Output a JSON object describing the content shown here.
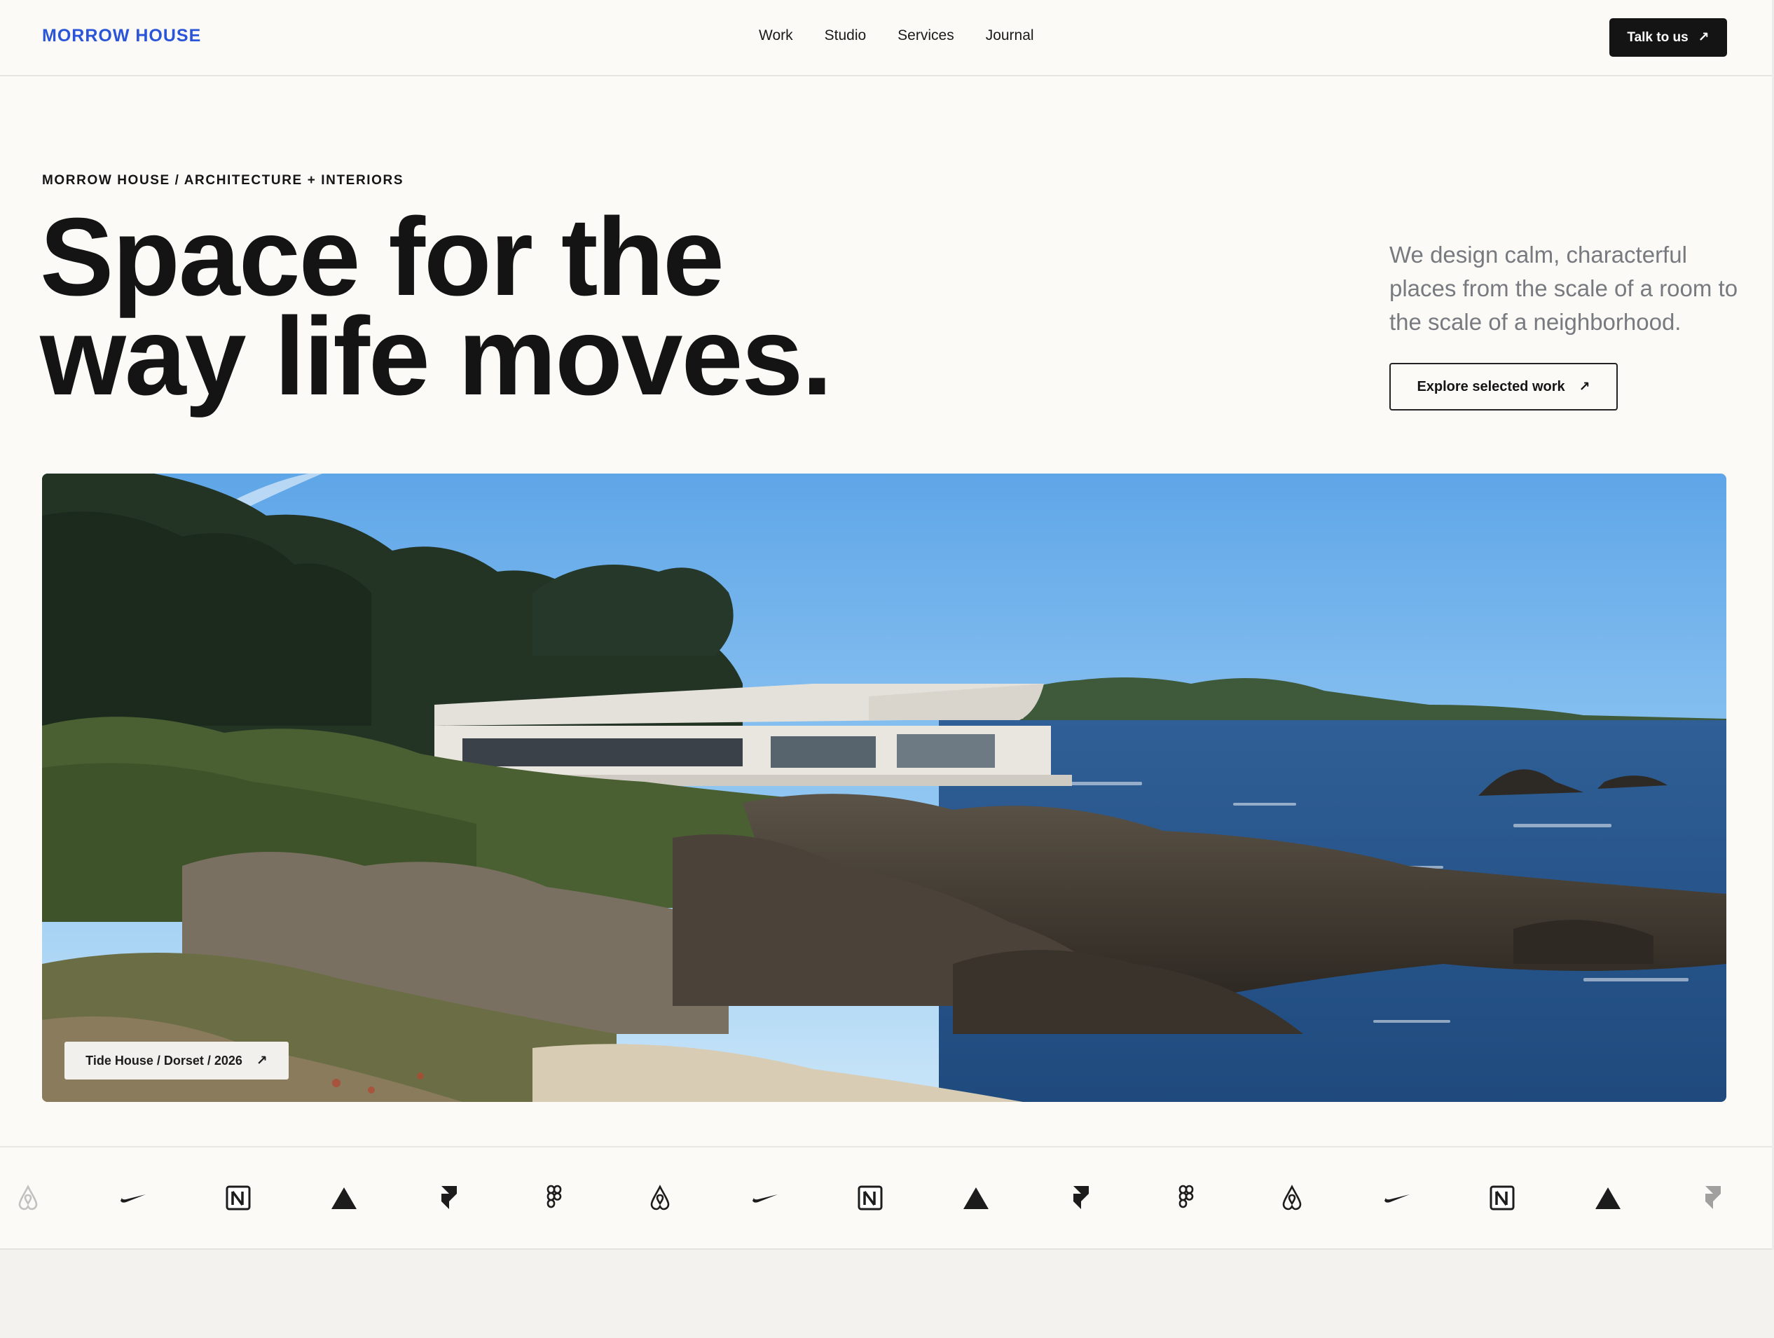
{
  "header": {
    "logo": "MORROW HOUSE",
    "nav": [
      "Work",
      "Studio",
      "Services",
      "Journal"
    ],
    "cta_label": "Talk to us",
    "cta_icon": "arrow-up-right-icon"
  },
  "hero": {
    "eyebrow": "MORROW HOUSE / ARCHITECTURE + INTERIORS",
    "headline_line1": "Space for the",
    "headline_line2": "way life moves.",
    "lede": "We design calm, characterful places from the scale of a room to the scale of a neighborhood.",
    "explore_label": "Explore selected work",
    "explore_icon": "arrow-up-right-icon"
  },
  "feature_image": {
    "subject": "coastal-house-photo",
    "caption": "Tide House / Dorset / 2026",
    "caption_icon": "arrow-up-right-icon"
  },
  "client_logos": [
    "airbnb-logo-icon",
    "nike-swoosh-icon",
    "notion-logo-icon",
    "vercel-triangle-icon",
    "framer-logo-icon",
    "figma-logo-icon",
    "airbnb-logo-icon",
    "nike-swoosh-icon",
    "notion-logo-icon",
    "vercel-triangle-icon",
    "framer-logo-icon",
    "figma-logo-icon",
    "airbnb-logo-icon",
    "nike-swoosh-icon",
    "notion-logo-icon",
    "vercel-triangle-icon",
    "framer-logo-icon"
  ],
  "colors": {
    "accent": "#2b55d9",
    "ink": "#141414",
    "background": "#fbfaf7",
    "muted_text": "#777a7f"
  }
}
